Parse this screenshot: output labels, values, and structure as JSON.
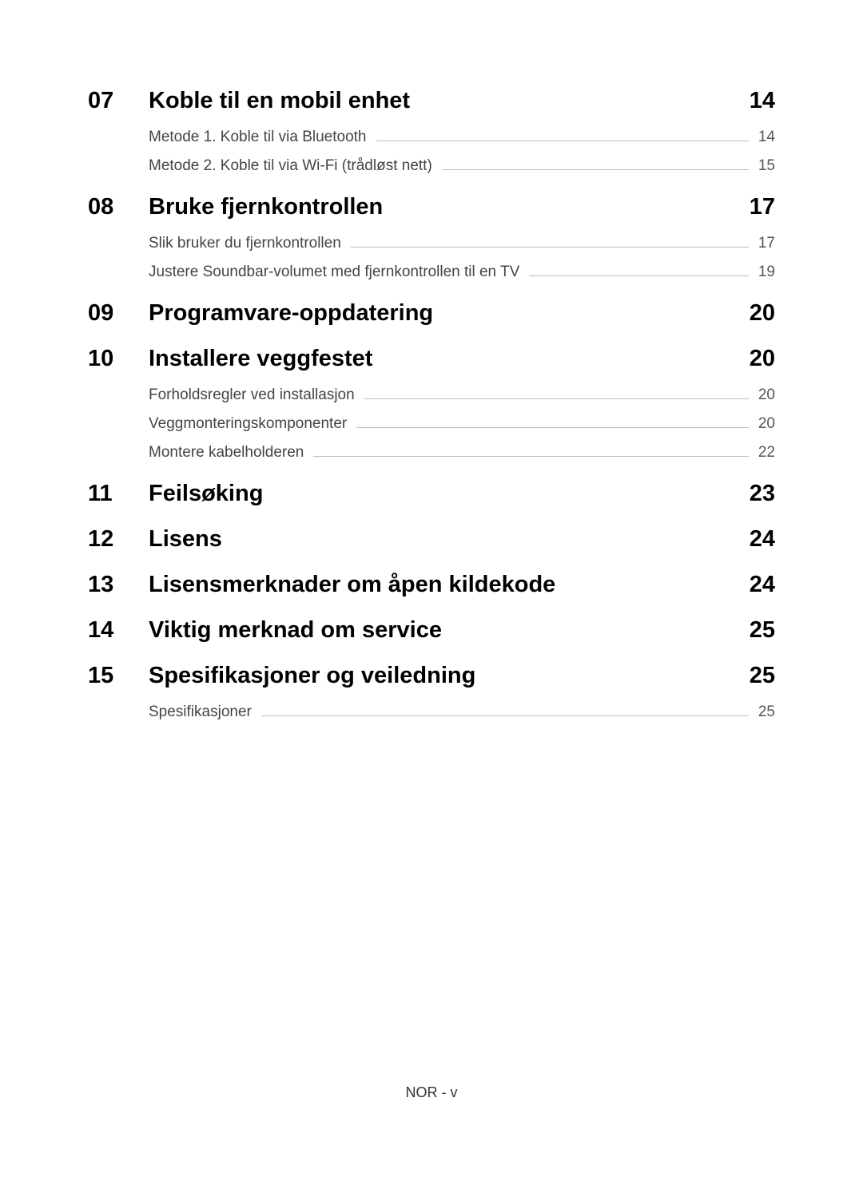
{
  "toc": {
    "sections": [
      {
        "number": "07",
        "title": "Koble til en mobil enhet",
        "page": "14",
        "subsections": [
          {
            "title": "Metode 1. Koble til via Bluetooth",
            "page": "14"
          },
          {
            "title": "Metode 2. Koble til via Wi-Fi (trådløst nett)",
            "page": "15"
          }
        ]
      },
      {
        "number": "08",
        "title": "Bruke fjernkontrollen",
        "page": "17",
        "subsections": [
          {
            "title": "Slik bruker du fjernkontrollen",
            "page": "17"
          },
          {
            "title": "Justere Soundbar-volumet med fjernkontrollen til en TV",
            "page": "19"
          }
        ]
      },
      {
        "number": "09",
        "title": "Programvare-oppdatering",
        "page": "20",
        "subsections": []
      },
      {
        "number": "10",
        "title": "Installere veggfestet",
        "page": "20",
        "subsections": [
          {
            "title": "Forholdsregler ved installasjon",
            "page": "20"
          },
          {
            "title": "Veggmonteringskomponenter",
            "page": "20"
          },
          {
            "title": "Montere kabelholderen",
            "page": "22"
          }
        ]
      },
      {
        "number": "11",
        "title": "Feilsøking",
        "page": "23",
        "subsections": []
      },
      {
        "number": "12",
        "title": "Lisens",
        "page": "24",
        "subsections": []
      },
      {
        "number": "13",
        "title": "Lisensmerknader om åpen kildekode",
        "page": "24",
        "subsections": []
      },
      {
        "number": "14",
        "title": "Viktig merknad om service",
        "page": "25",
        "subsections": []
      },
      {
        "number": "15",
        "title": "Spesifikasjoner og veiledning",
        "page": "25",
        "subsections": [
          {
            "title": "Spesifikasjoner",
            "page": "25"
          }
        ]
      }
    ]
  },
  "footer": "NOR - v"
}
